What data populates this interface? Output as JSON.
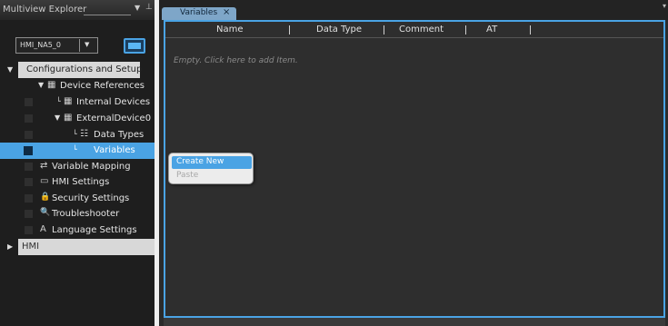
{
  "explorer": {
    "title": "Multiview Explorer",
    "dropdown_icon": "chevron-down-icon",
    "pin_icon": "pin-icon",
    "device_select": {
      "value": "HMI_NA5_0"
    },
    "tree": [
      {
        "label": "Configurations and Setup",
        "icon": "",
        "expander": "▼"
      },
      {
        "label": "Device References",
        "icon": "▦",
        "expander": "▼"
      },
      {
        "label": "Internal Devices",
        "icon": "▦",
        "expander": ""
      },
      {
        "label": "ExternalDevice0",
        "icon": "▦",
        "expander": "▼"
      },
      {
        "label": "Data Types",
        "icon": "☷",
        "expander": ""
      },
      {
        "label": "Variables",
        "icon": "",
        "expander": ""
      },
      {
        "label": "Variable Mapping",
        "icon": "⇄",
        "expander": ""
      },
      {
        "label": "HMI Settings",
        "icon": "▭",
        "expander": ""
      },
      {
        "label": "Security Settings",
        "icon": "🔒",
        "expander": ""
      },
      {
        "label": "Troubleshooter",
        "icon": "🔍",
        "expander": ""
      },
      {
        "label": "Language Settings",
        "icon": "A",
        "expander": ""
      },
      {
        "label": "HMI",
        "icon": "",
        "expander": "▶"
      }
    ]
  },
  "editor": {
    "tab": {
      "label": "Variables",
      "close": "×"
    },
    "columns": [
      "Name",
      "Data Type",
      "Comment",
      "AT"
    ],
    "empty_hint": "Empty. Click here to add Item.",
    "context_menu": {
      "create_new": "Create New",
      "paste": "Paste"
    }
  },
  "colors": {
    "accent": "#4aa3e4",
    "pane_bg": "#1e1e1e",
    "editor_bg": "#2e2e2e"
  }
}
